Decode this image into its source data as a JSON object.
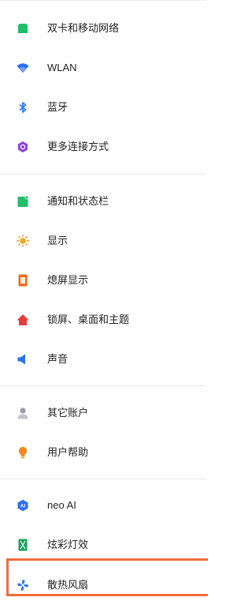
{
  "settings": {
    "items": [
      {
        "label": "双卡和移动网络",
        "icon": "sim-card-icon"
      },
      {
        "label": "WLAN",
        "icon": "wifi-icon"
      },
      {
        "label": "蓝牙",
        "icon": "bluetooth-icon"
      },
      {
        "label": "更多连接方式",
        "icon": "more-connections-icon"
      },
      {
        "label": "通知和状态栏",
        "icon": "notification-icon"
      },
      {
        "label": "显示",
        "icon": "sun-icon"
      },
      {
        "label": "熄屏显示",
        "icon": "always-on-display-icon"
      },
      {
        "label": "锁屏、桌面和主题",
        "icon": "home-icon"
      },
      {
        "label": "声音",
        "icon": "speaker-icon"
      },
      {
        "label": "其它账户",
        "icon": "account-icon"
      },
      {
        "label": "用户帮助",
        "icon": "lightbulb-icon"
      },
      {
        "label": "neo AI",
        "icon": "ai-icon"
      },
      {
        "label": "炫彩灯效",
        "icon": "phone-light-icon"
      },
      {
        "label": "散热风扇",
        "icon": "fan-icon"
      }
    ]
  },
  "colors": {
    "highlight": "#f26b3a",
    "divider": "#e6e6e6",
    "text": "#222222"
  }
}
